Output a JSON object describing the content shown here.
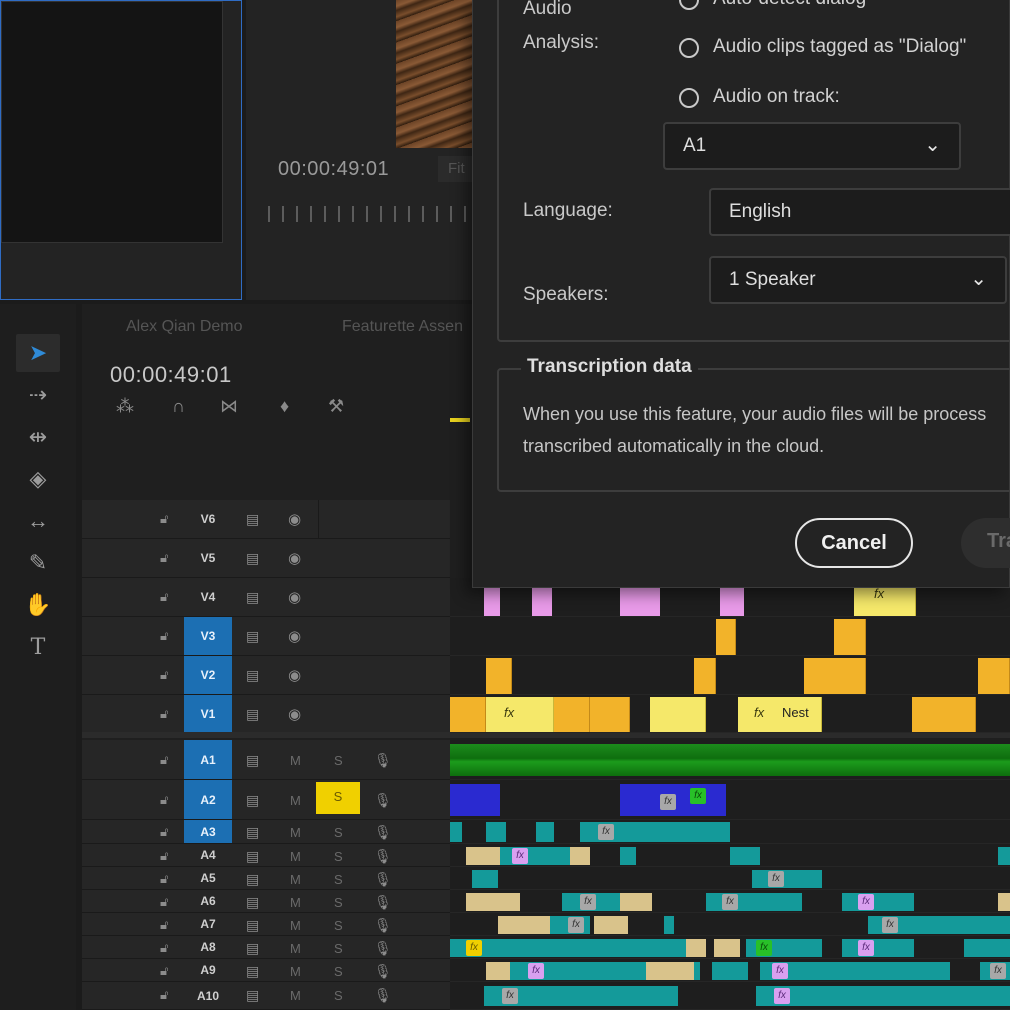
{
  "source_monitor": {},
  "program_monitor": {
    "timecode": "00:00:49:01",
    "fit_label": "Fit"
  },
  "timeline": {
    "tabs": [
      "Alex Qian Demo",
      "Featurette Assen"
    ],
    "timecode": "00:00:49:01",
    "video_tracks": [
      {
        "name": "V6",
        "targeted": false
      },
      {
        "name": "V5",
        "targeted": false
      },
      {
        "name": "V4",
        "targeted": false
      },
      {
        "name": "V3",
        "targeted": true
      },
      {
        "name": "V2",
        "targeted": true
      },
      {
        "name": "V1",
        "targeted": true
      }
    ],
    "audio_tracks": [
      {
        "name": "A1",
        "targeted": true,
        "solo": false
      },
      {
        "name": "A2",
        "targeted": true,
        "solo": true
      },
      {
        "name": "A3",
        "targeted": true,
        "solo": false
      },
      {
        "name": "A4",
        "targeted": false,
        "solo": false
      },
      {
        "name": "A5",
        "targeted": false,
        "solo": false
      },
      {
        "name": "A6",
        "targeted": false,
        "solo": false
      },
      {
        "name": "A7",
        "targeted": false,
        "solo": false
      },
      {
        "name": "A8",
        "targeted": false,
        "solo": false
      },
      {
        "name": "A9",
        "targeted": false,
        "solo": false
      },
      {
        "name": "A10",
        "targeted": false,
        "solo": false
      }
    ],
    "mute_label": "M",
    "solo_label": "S",
    "fx_label": "fx",
    "nest_label": "Nest"
  },
  "dialog": {
    "audio_analysis_label_1": "Audio",
    "audio_analysis_label_2": "Analysis:",
    "options": [
      "Auto-detect dialog",
      "Audio clips tagged as \"Dialog\"",
      "Audio on track:"
    ],
    "track_value": "A1",
    "language_label": "Language:",
    "language_value": "English",
    "speakers_label": "Speakers:",
    "speakers_value": "1 Speaker",
    "transcription_legend": "Transcription data",
    "transcription_line1": "When you use this feature, your audio files will be process",
    "transcription_line2": "transcribed automatically in the cloud.",
    "cancel_label": "Cancel",
    "transcribe_label": "Tra"
  },
  "colors": {
    "accent_blue": "#1c6fb3",
    "solo_yellow": "#f0d000",
    "playhead": "#e8d21f"
  }
}
